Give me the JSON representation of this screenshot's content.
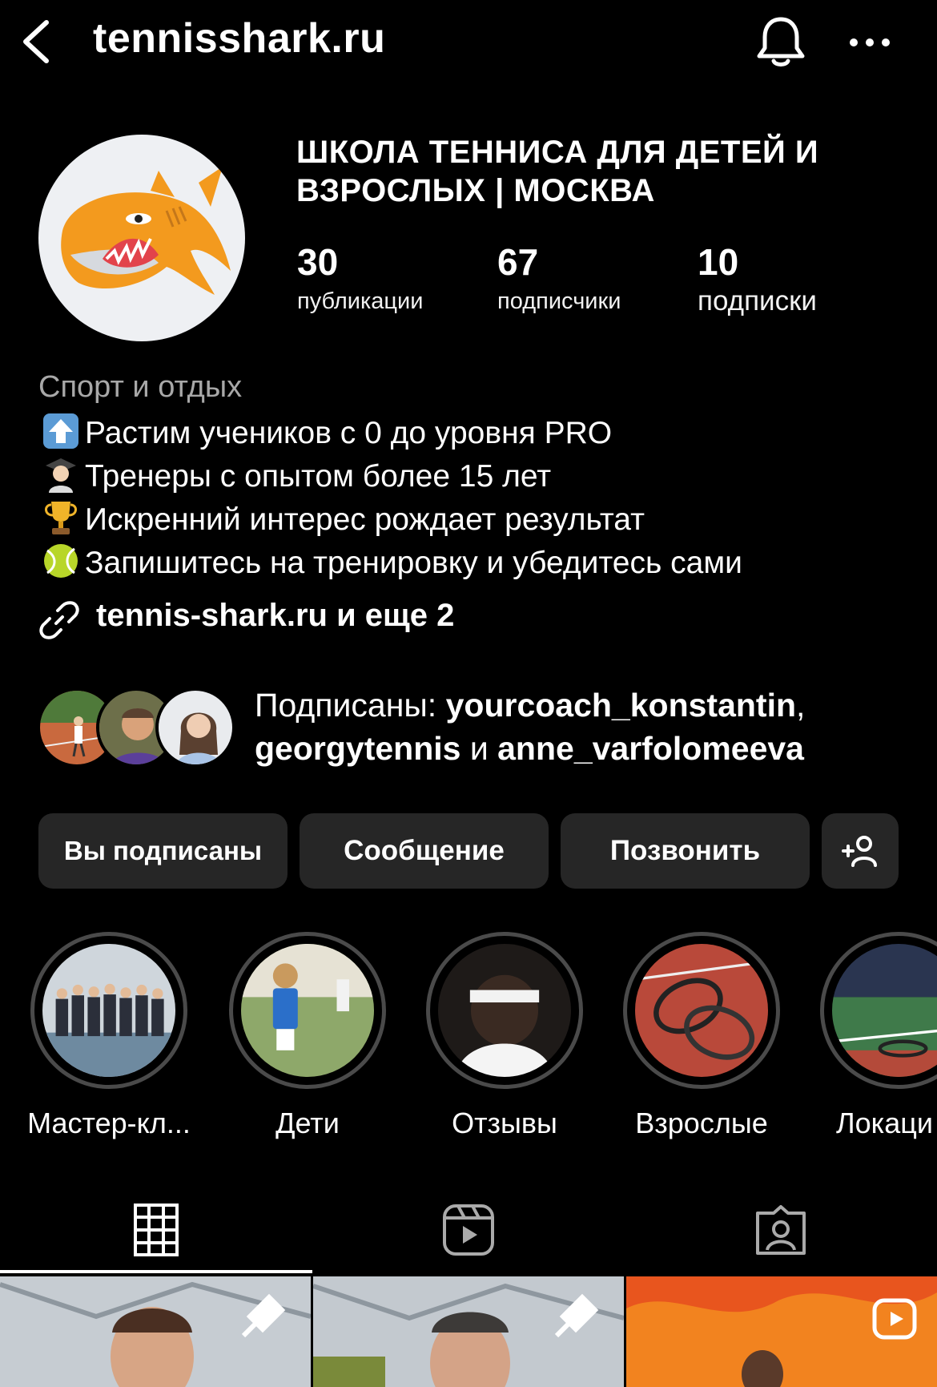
{
  "header": {
    "username": "tennisshark.ru",
    "icons": [
      "back-icon",
      "bell-icon",
      "more-icon"
    ]
  },
  "profile": {
    "display_name": "ШКОЛА ТЕННИСА ДЛЯ ДЕТЕЙ И ВЗРОСЛЫХ | МОСКВА",
    "stats": [
      {
        "value": "30",
        "label": "публикации"
      },
      {
        "value": "67",
        "label": "подписчики"
      },
      {
        "value": "10",
        "label": "подписки"
      }
    ]
  },
  "bio": {
    "category": "Спорт и отдых",
    "lines": [
      {
        "emoji": "up-arrow-emoji",
        "text": "Растим учеников с 0 до уровня PRO"
      },
      {
        "emoji": "graduate-emoji",
        "text": "Тренеры с опытом более 15 лет"
      },
      {
        "emoji": "trophy-emoji",
        "text": "Искренний интерес рождает результат"
      },
      {
        "emoji": "tennis-ball-emoji",
        "text": "Запишитесь на тренировку и убедитесь сами"
      }
    ],
    "link": "tennis-shark.ru и еще 2"
  },
  "followed_by": {
    "prefix": "Подписаны: ",
    "user1": "yourcoach_konstantin",
    "comma": ",",
    "user2": "georgytennis",
    "and": " и ",
    "user3": "anne_varfolomeeva"
  },
  "buttons": {
    "following": "Вы подписаны",
    "message": "Сообщение",
    "call": "Позвонить",
    "add_user_icon": "add-person-icon"
  },
  "highlights": [
    {
      "label": "Мастер-кл..."
    },
    {
      "label": "Дети"
    },
    {
      "label": "Отзывы"
    },
    {
      "label": "Взрослые"
    },
    {
      "label": "Локаци"
    }
  ],
  "tabs": [
    {
      "icon": "grid-icon",
      "active": true
    },
    {
      "icon": "reels-icon",
      "active": false
    },
    {
      "icon": "tagged-icon",
      "active": false
    }
  ],
  "colors": {
    "background": "#000000",
    "button": "#262626",
    "secondary_text": "#a8a8a8",
    "ring": "#4a4a4a"
  }
}
